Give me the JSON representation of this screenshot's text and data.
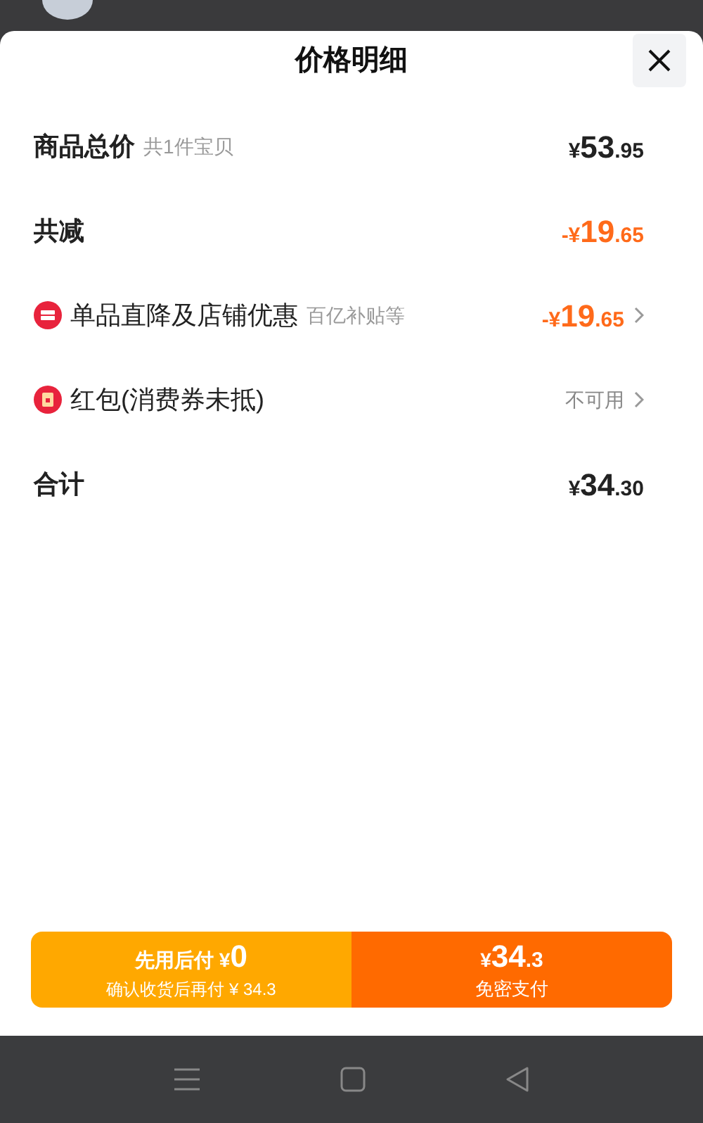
{
  "title": "价格明细",
  "rows": [
    {
      "kind": "plain",
      "label": "商品总价",
      "note": "共1件宝贝",
      "amount": {
        "prefix": "¥",
        "main": "53",
        "fraction": ".95"
      },
      "highlight": false
    },
    {
      "kind": "plain",
      "label": "共减",
      "amount": {
        "prefix": "-¥",
        "main": "19",
        "fraction": ".65"
      },
      "highlight": true
    },
    {
      "kind": "discount",
      "label": "单品直降及店铺优惠",
      "note": "百亿补贴等",
      "amount": {
        "prefix": "-¥",
        "main": "19",
        "fraction": ".65"
      },
      "highlight": true
    },
    {
      "kind": "packet",
      "label": "红包(消费券未抵)",
      "status": "不可用"
    },
    {
      "kind": "plain",
      "label": "合计",
      "amount": {
        "prefix": "¥",
        "main": "34",
        "fraction": ".30"
      },
      "highlight": false
    }
  ],
  "pay_later": {
    "label": "先用后付",
    "prefix": "¥",
    "amount": "0",
    "subtitle": "确认收货后再付 ¥ 34.3"
  },
  "pay_now": {
    "prefix": "¥",
    "main": "34",
    "fraction": ".3",
    "subtitle": "免密支付"
  }
}
